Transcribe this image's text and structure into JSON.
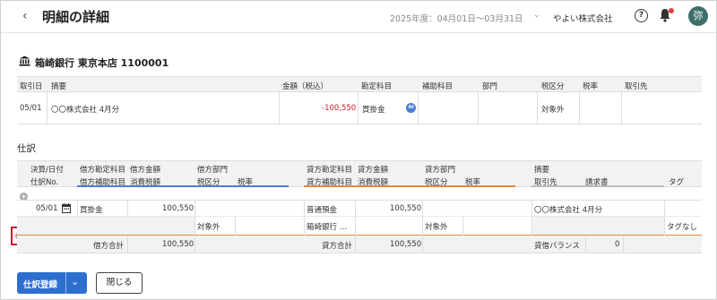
{
  "header": {
    "title": "明細の詳細",
    "period": "2025年度：04月01日〜03月31日",
    "company": "やよい株式会社",
    "avatar_text": "弥",
    "help_text": "?"
  },
  "account": {
    "name": "箱崎銀行 東京本店 1100001"
  },
  "detail_table": {
    "headers": [
      "取引日",
      "摘要",
      "金額（税込）",
      "勘定科目",
      "補助科目",
      "部門",
      "税区分",
      "税率",
      "取引先"
    ],
    "row": {
      "date": "05/01",
      "description": "〇〇株式会社 4月分",
      "amount": "-100,550",
      "account": "買掛金",
      "ai_badge": "AI",
      "tax_category": "対象外"
    }
  },
  "journal": {
    "section_title": "仕訳",
    "headers_top": [
      "決算/日付",
      "借方勘定科目",
      "借方金額",
      "借方部門",
      "貸方勘定科目",
      "貸方金額",
      "貸方部門",
      "摘要"
    ],
    "headers_bottom": [
      "仕訳No.",
      "借方補助科目",
      "消費税額",
      "税区分",
      "税率",
      "貸方補助科目",
      "消費税額",
      "税区分",
      "税率",
      "取引先",
      "請求書",
      "タグ"
    ],
    "row": {
      "date": "05/01",
      "debit_account": "買掛金",
      "debit_amount": "100,550",
      "credit_account": "普通預金",
      "credit_amount": "100,550",
      "description": "〇〇株式会社 4月分",
      "debit_tax_category": "対象外",
      "credit_sub_account": "箱崎銀行 …",
      "credit_tax_category": "対象外",
      "tag": "タグなし"
    },
    "totals": {
      "debit_label": "借方合計",
      "debit_total": "100,550",
      "credit_label": "貸方合計",
      "credit_total": "100,550",
      "balance_label": "貸借バランス",
      "balance_value": "0"
    }
  },
  "buttons": {
    "register": "仕訳登録",
    "close": "閉じる"
  },
  "colors": {
    "primary": "#2d6fcf",
    "debit_accent": "#4a7fd0",
    "credit_accent": "#e08a3c",
    "negative": "#d0172a",
    "highlight_box": "#d0172a"
  }
}
